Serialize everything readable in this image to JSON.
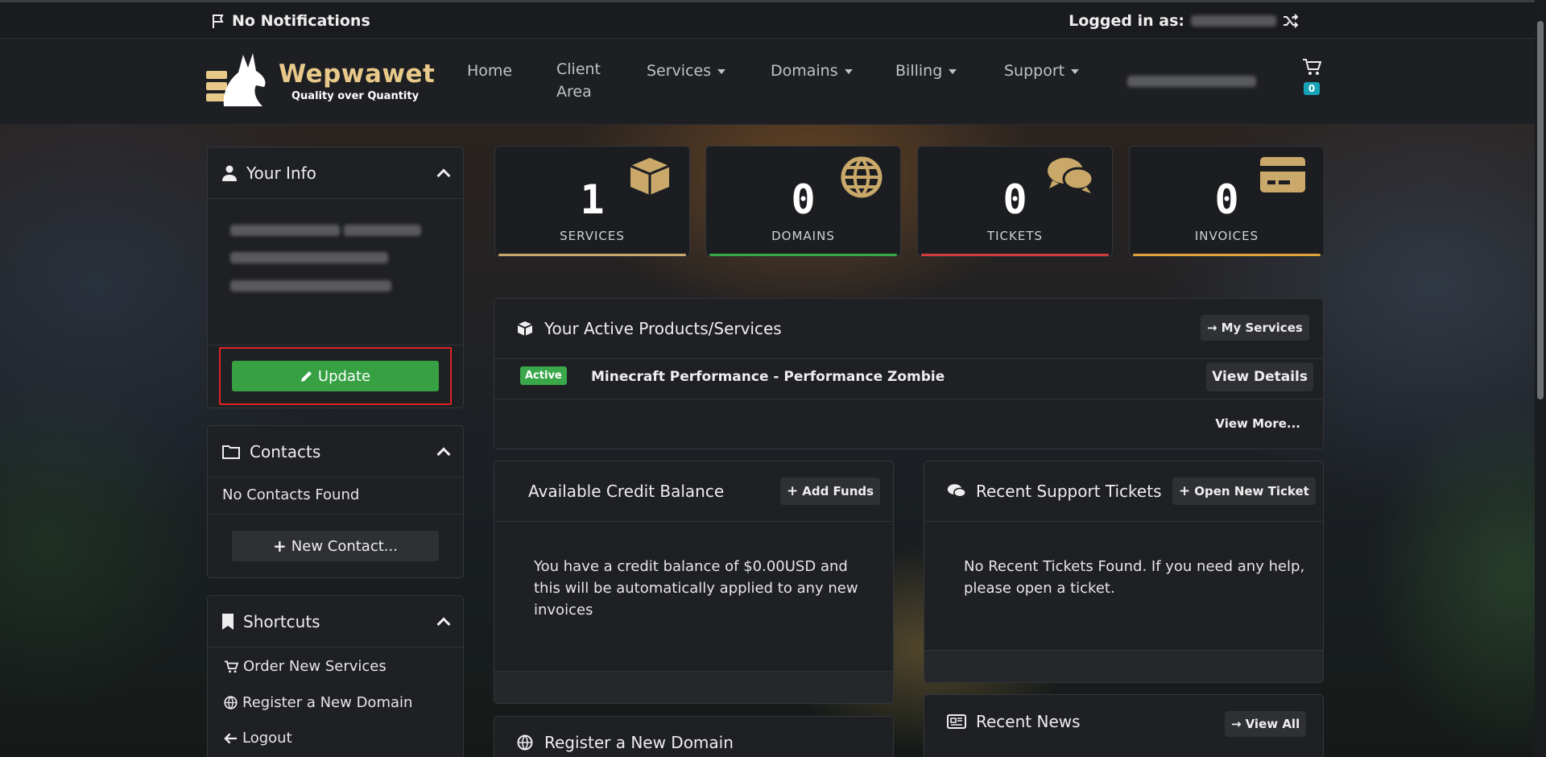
{
  "topbar": {
    "notifications": "No Notifications",
    "logged_in_label": "Logged in as:"
  },
  "brand": {
    "name": "Wepwawet",
    "tagline": "Quality over Quantity",
    "accent": "#e8c98a"
  },
  "nav": {
    "home": "Home",
    "client_area_1": "Client",
    "client_area_2": "Area",
    "services": "Services",
    "domains": "Domains",
    "billing": "Billing",
    "support": "Support",
    "cart_count": "0"
  },
  "your_info": {
    "title": "Your Info",
    "update_label": "Update"
  },
  "contacts": {
    "title": "Contacts",
    "empty": "No Contacts Found",
    "new_label": "New Contact..."
  },
  "shortcuts": {
    "title": "Shortcuts",
    "items": [
      "Order New Services",
      "Register a New Domain",
      "Logout"
    ]
  },
  "stats": [
    {
      "value": "1",
      "label": "SERVICES",
      "color": "#c9a86a"
    },
    {
      "value": "0",
      "label": "DOMAINS",
      "color": "#3aa84a"
    },
    {
      "value": "0",
      "label": "TICKETS",
      "color": "#d23a3a"
    },
    {
      "value": "0",
      "label": "INVOICES",
      "color": "#e0a23a"
    }
  ],
  "active_products": {
    "title": "Your Active Products/Services",
    "my_services": "My Services",
    "status": "Active",
    "product": "Minecraft Performance - Performance Zombie",
    "view_details": "View Details",
    "view_more": "View More..."
  },
  "credit": {
    "title": "Available Credit Balance",
    "add_funds": "Add Funds",
    "line1": "You have a credit balance of $0.00USD and",
    "line2": "this will be automatically applied to any new",
    "line3": "invoices"
  },
  "tickets": {
    "title": "Recent Support Tickets",
    "open_new": "Open New Ticket",
    "line1": "No Recent Tickets Found. If you need any help,",
    "line2": "please open a ticket."
  },
  "register_domain": {
    "title": "Register a New Domain"
  },
  "news": {
    "title": "Recent News",
    "view_all": "View All"
  }
}
